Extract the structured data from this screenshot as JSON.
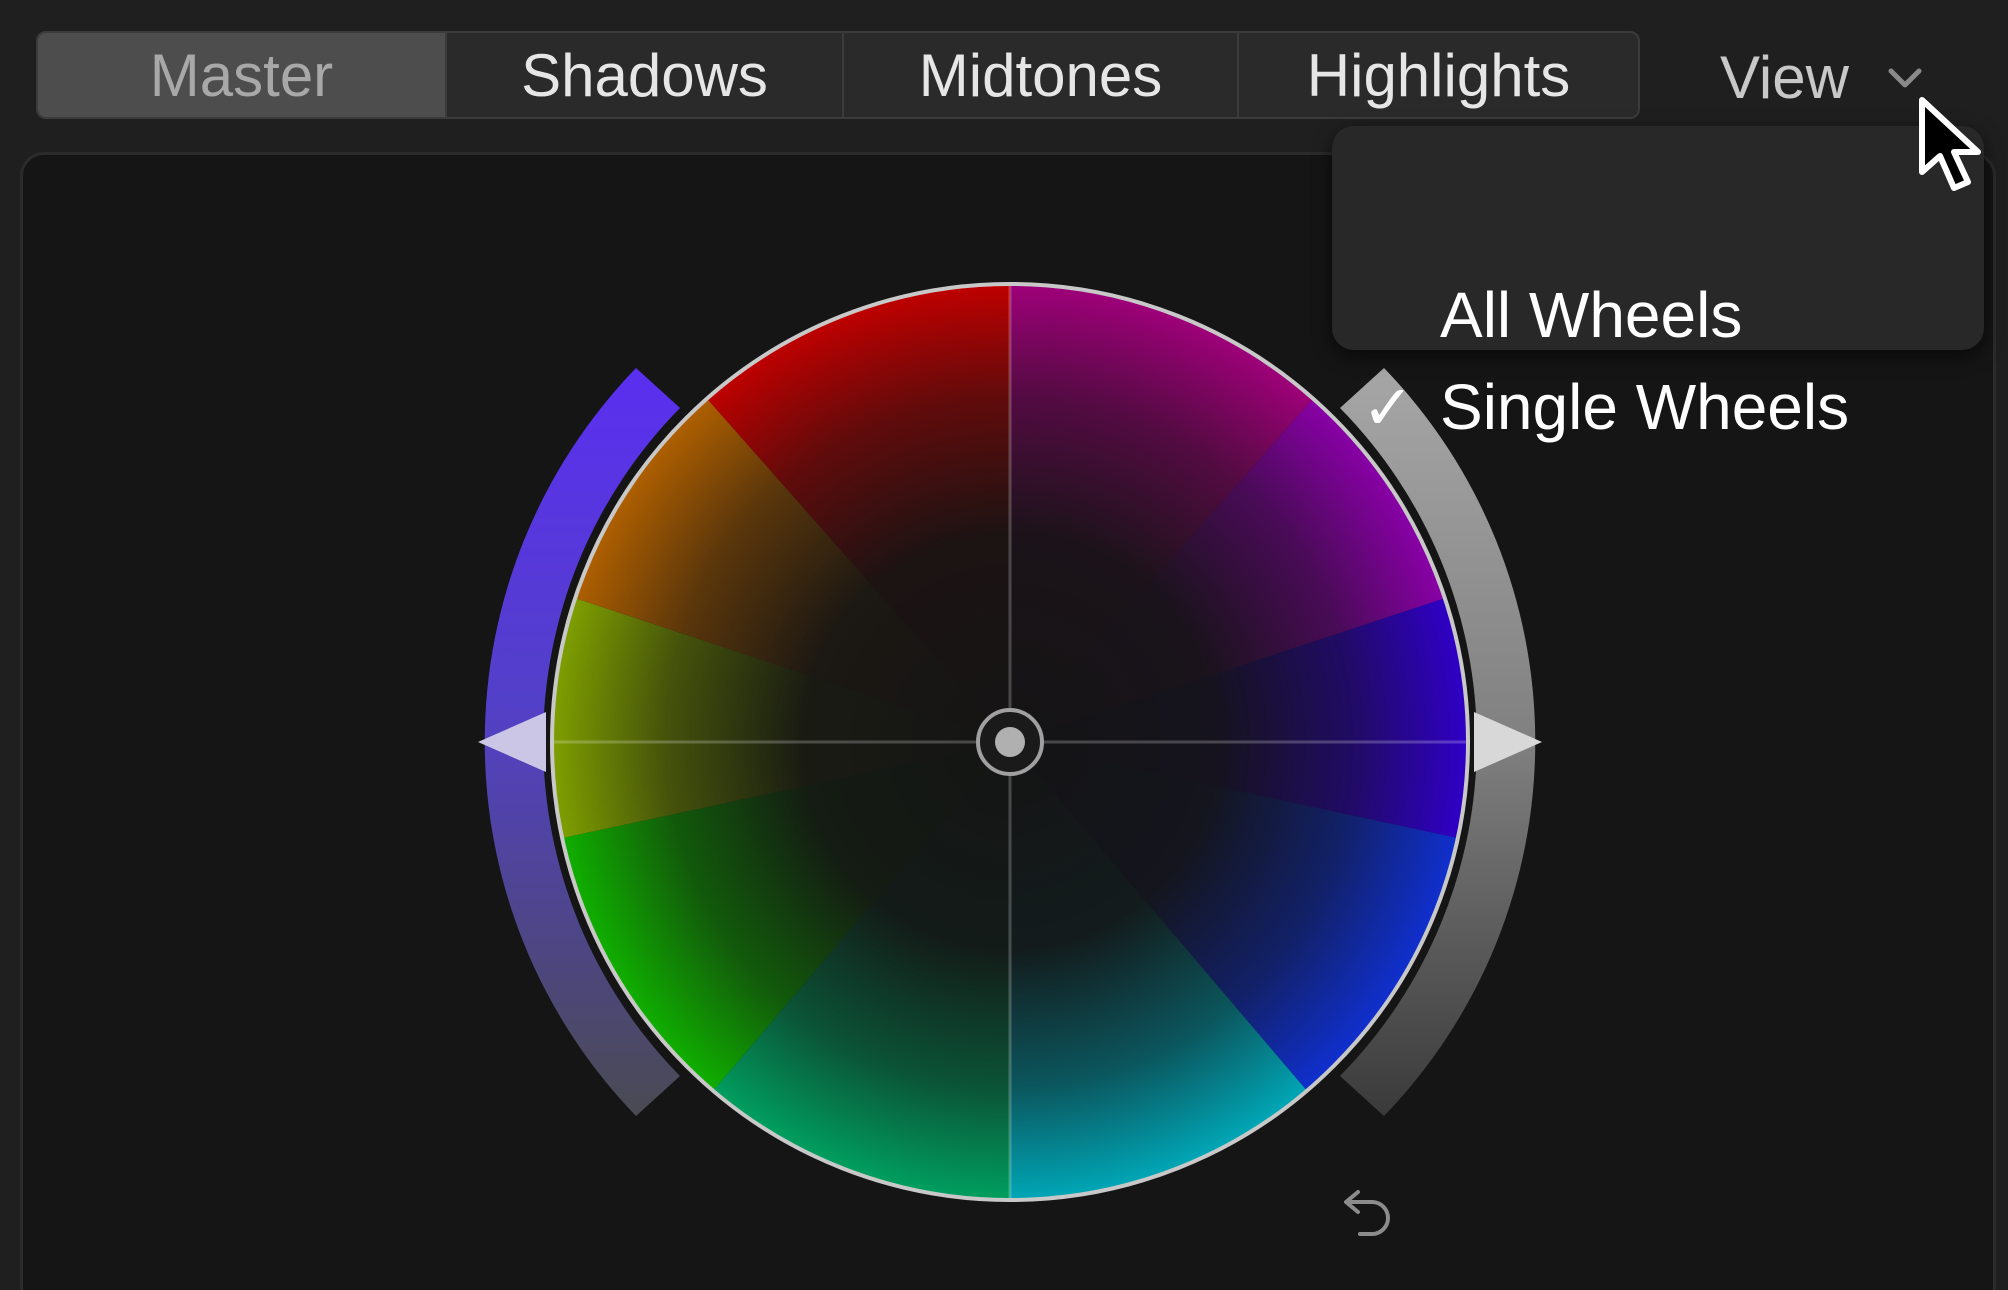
{
  "tabs": [
    {
      "label": "Master",
      "active": true
    },
    {
      "label": "Shadows",
      "active": false
    },
    {
      "label": "Midtones",
      "active": false
    },
    {
      "label": "Highlights",
      "active": false
    }
  ],
  "view_menu": {
    "label": "View",
    "items": [
      {
        "label": "All Wheels",
        "checked": false,
        "check_glyph": ""
      },
      {
        "label": "Single Wheels",
        "checked": true,
        "check_glyph": "✓"
      }
    ]
  },
  "icons": {
    "view_chevron": "chevron-down-icon",
    "wheel_center": "puck-icon",
    "reset": "reset-arrow-icon",
    "cursor": "pointer-cursor-icon"
  },
  "colors": {
    "saturation_slider": "#5a3cf0",
    "brightness_slider": "#9a9a9a",
    "panel_bg": "#151516",
    "menu_bg": "#282829"
  }
}
